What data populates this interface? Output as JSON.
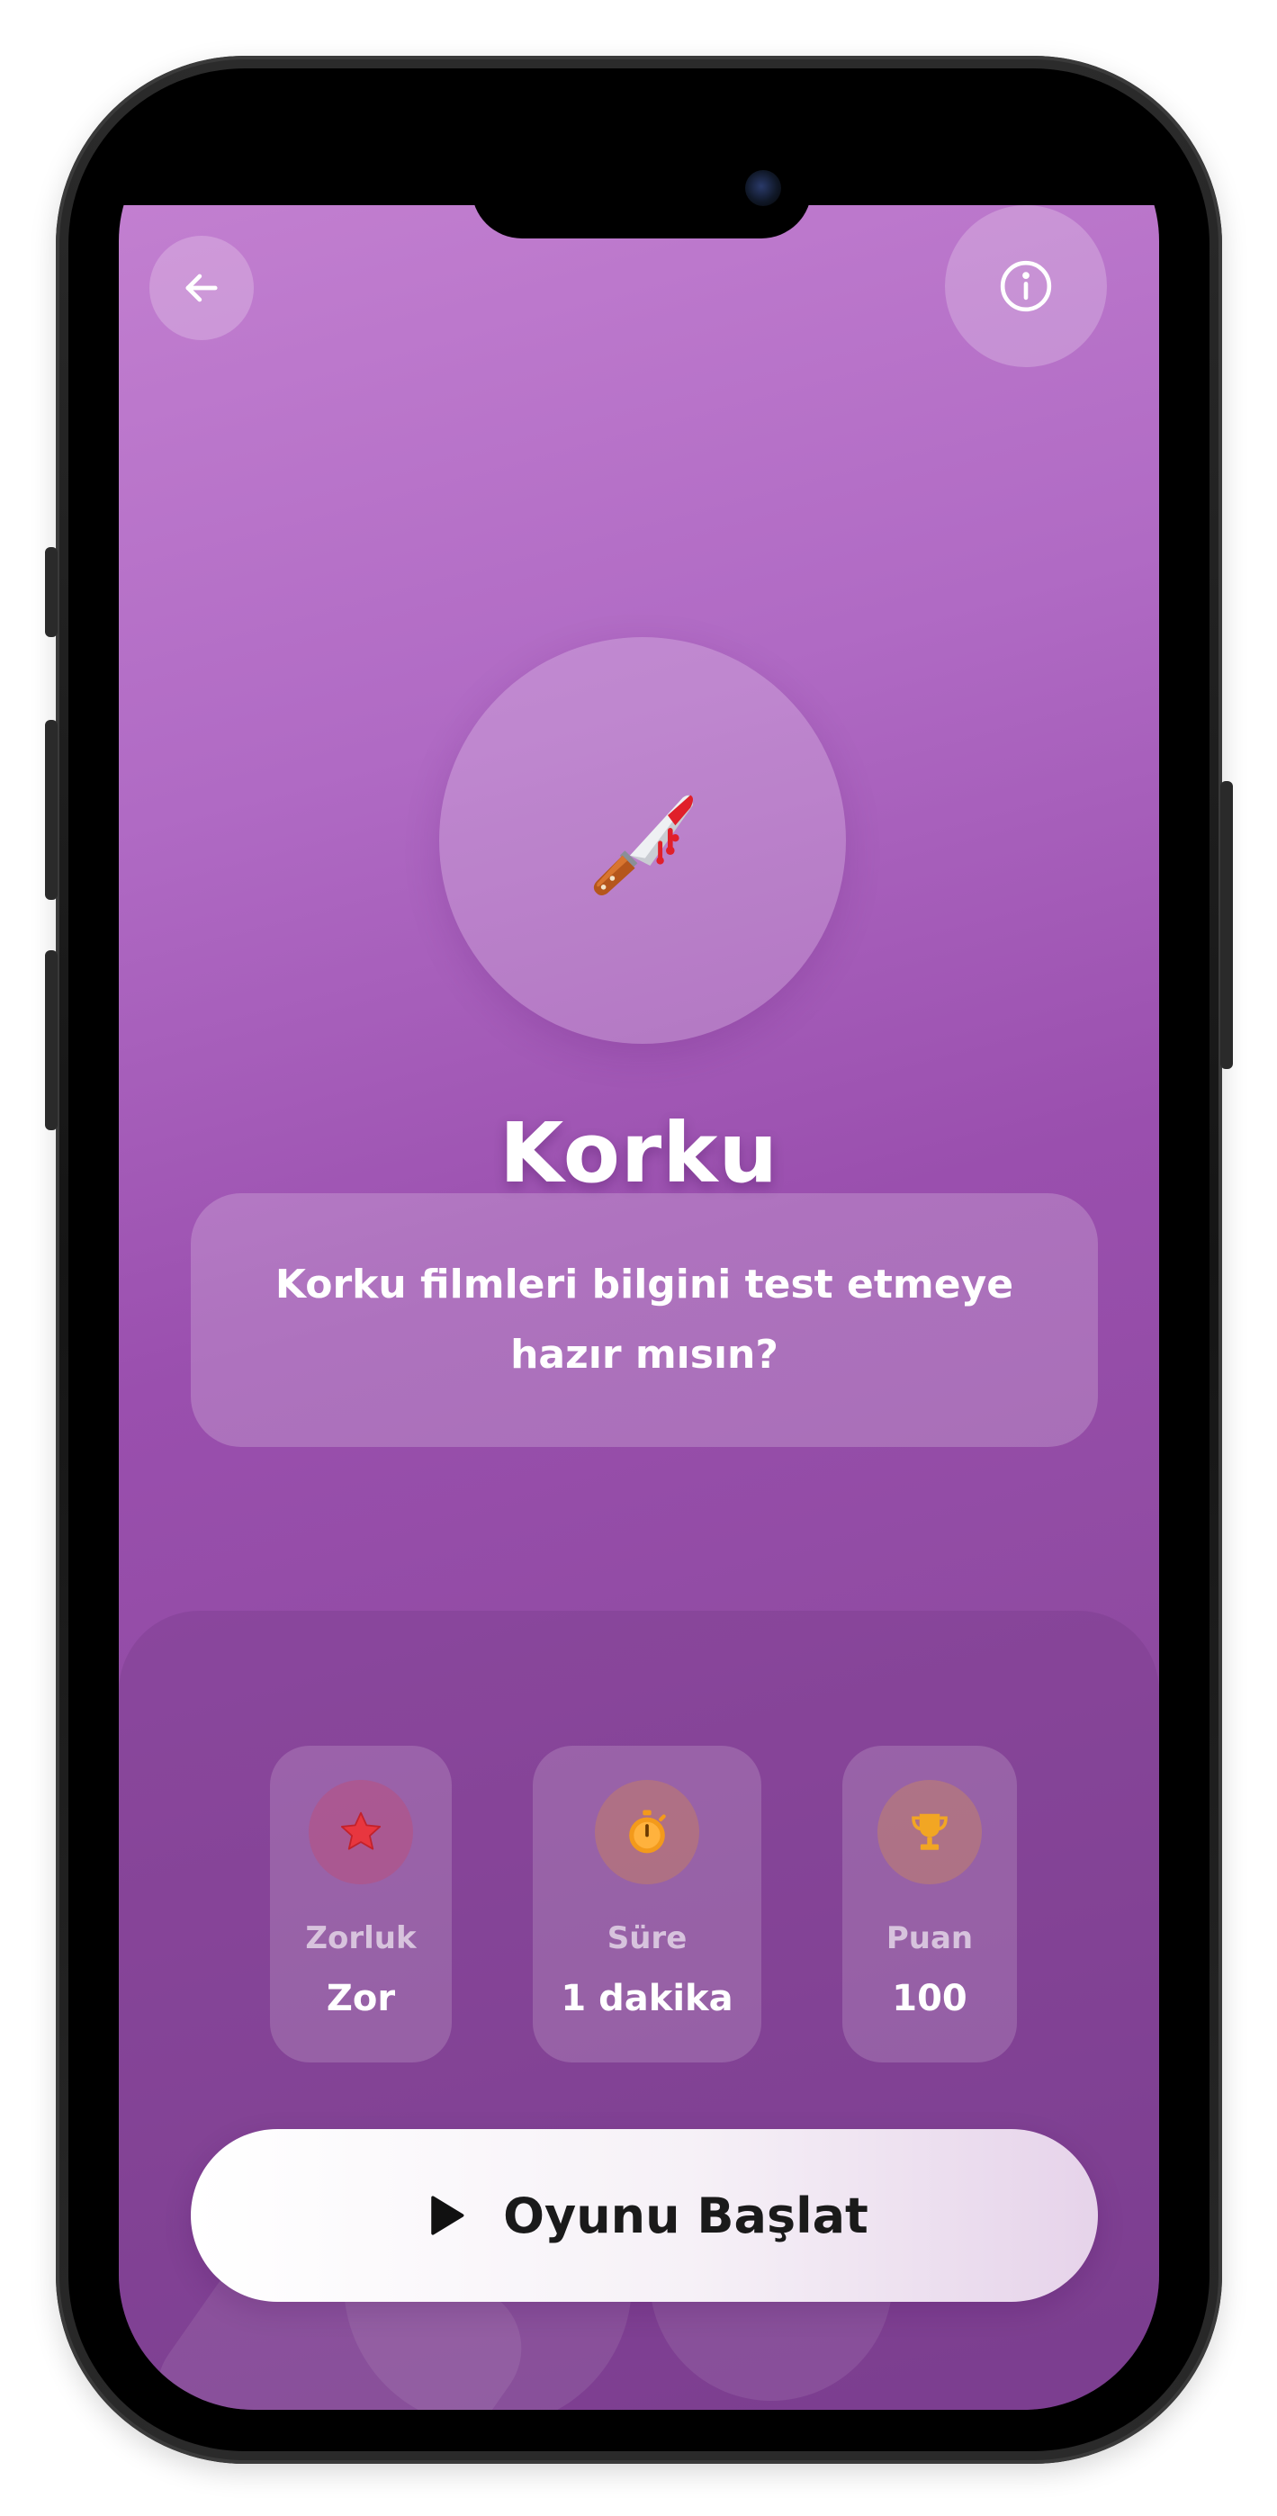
{
  "header": {
    "back_icon": "arrow-left-icon",
    "info_icon": "info-circle-icon"
  },
  "hero": {
    "icon": "bloody-knife-emoji",
    "title": "Korku"
  },
  "description": "Korku filmleri bilgini test etmeye hazır mısın?",
  "stats": [
    {
      "icon": "star-icon",
      "label": "Zorluk",
      "value": "Zor",
      "color": "#e8363f"
    },
    {
      "icon": "stopwatch-icon",
      "label": "Süre",
      "value": "1 dakika",
      "color": "#f39a1b"
    },
    {
      "icon": "trophy-icon",
      "label": "Puan",
      "value": "100",
      "color": "#f2a623"
    }
  ],
  "start_button": {
    "icon": "play-icon",
    "label": "Oyunu Başlat"
  },
  "colors": {
    "gradient_top": "#c27fd0",
    "gradient_bottom": "#7d3f92",
    "accent_white": "#ffffff"
  }
}
